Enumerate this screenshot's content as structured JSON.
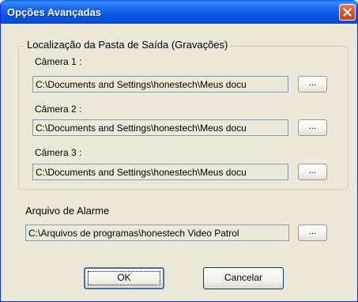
{
  "window": {
    "title": "Opções Avançadas"
  },
  "output_folder": {
    "legend": "Localização da Pasta de Saída (Gravações)",
    "cameras": [
      {
        "label": "Câmera 1 :",
        "path": "C:\\Documents and Settings\\honestech\\Meus docu",
        "browse_label": "..."
      },
      {
        "label": "Câmera 2 :",
        "path": "C:\\Documents and Settings\\honestech\\Meus docu",
        "browse_label": "..."
      },
      {
        "label": "Câmera 3 :",
        "path": "C:\\Documents and Settings\\honestech\\Meus docu",
        "browse_label": "..."
      }
    ]
  },
  "alarm": {
    "label": "Arquivo de Alarme",
    "path": "C:\\Arquivos de programas\\honestech Video Patrol",
    "browse_label": "..."
  },
  "buttons": {
    "ok_label": "OK",
    "cancel_label": "Cancelar"
  },
  "colors": {
    "titlebar": "#0a57e6",
    "dialog_bg": "#ece9d8",
    "close_button": "#dc5a32"
  },
  "icons": {
    "close": "close-icon"
  }
}
